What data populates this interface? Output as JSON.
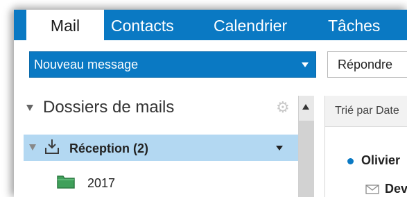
{
  "tabs": [
    {
      "label": "Mail",
      "active": true
    },
    {
      "label": "Contacts",
      "active": false
    },
    {
      "label": "Calendrier",
      "active": false
    },
    {
      "label": "Tâches",
      "active": false
    }
  ],
  "toolbar": {
    "new_message_label": "Nouveau message",
    "reply_label": "Répondre"
  },
  "folders": {
    "header": "Dossiers de mails",
    "settings_icon": "gear-icon",
    "inbox": {
      "label": "Réception (2)",
      "icon": "inbox-download-icon",
      "selected": true
    },
    "subfolders": [
      {
        "label": "2017",
        "icon": "folder-icon"
      }
    ]
  },
  "message_list": {
    "sort_label": "Trié par Date",
    "messages": [
      {
        "sender": "Olivier",
        "subject": "Dev",
        "unread": true
      }
    ]
  },
  "colors": {
    "accent": "#0a79c3",
    "selection": "#b3d8f2"
  }
}
